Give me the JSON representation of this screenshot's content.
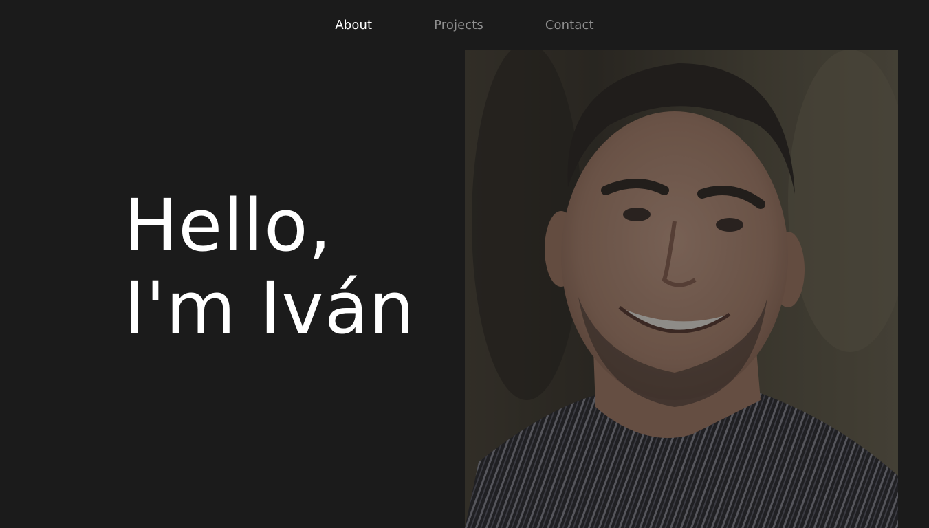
{
  "nav": {
    "items": [
      {
        "label": "About",
        "active": true
      },
      {
        "label": "Projects",
        "active": false
      },
      {
        "label": "Contact",
        "active": false
      }
    ]
  },
  "hero": {
    "line1": "Hello,",
    "line2": "I'm Iván"
  },
  "colors": {
    "background": "#1b1b1b",
    "nav_active": "#ffffff",
    "nav_inactive": "#8f8f8f",
    "heading": "#ffffff"
  }
}
